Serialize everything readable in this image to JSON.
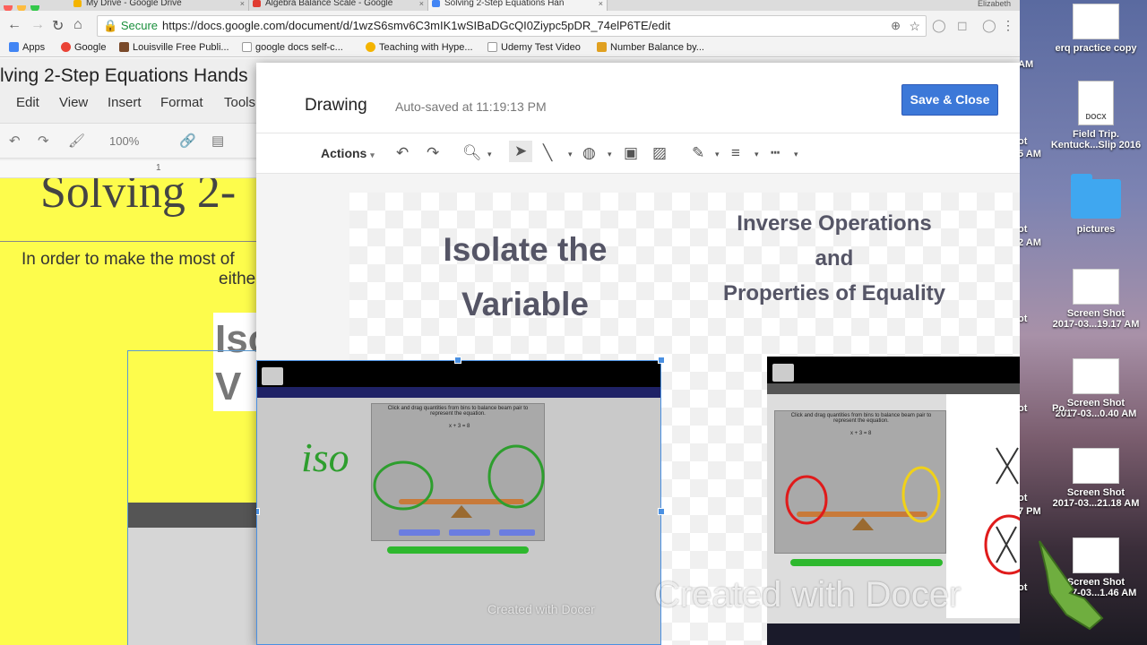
{
  "browser": {
    "tabs": [
      {
        "label": "My Drive - Google Drive",
        "color": "#f4b400"
      },
      {
        "label": "Algebra Balance Scale - Google",
        "color": "#e03c31"
      },
      {
        "label": "Solving 2-Step Equations Han",
        "color": "#4285f4"
      }
    ],
    "tab_close": "×",
    "user_label": "Elizabeth",
    "secure_label": "Secure",
    "url": "https://docs.google.com/document/d/1wzS6smv6C3mIK1wSIBaDGcQI0Ziypc5pDR_74elP6TE/edit",
    "bookmarks": [
      {
        "label": "Apps",
        "icon": "apps-icon"
      },
      {
        "label": "Google",
        "icon": "google-icon"
      },
      {
        "label": "Louisville Free Publi...",
        "icon": "library-icon"
      },
      {
        "label": "google docs self-c...",
        "icon": "page-icon"
      },
      {
        "label": "Teaching with Hype...",
        "icon": "pin-icon"
      },
      {
        "label": "Udemy Test Video",
        "icon": "page-icon"
      },
      {
        "label": "Number Balance by...",
        "icon": "balance-icon"
      }
    ]
  },
  "docs": {
    "title": "lving 2-Step Equations Hands",
    "menu": [
      "Edit",
      "View",
      "Insert",
      "Format",
      "Tools"
    ],
    "zoom": "100%",
    "ruler_mark": "1",
    "page_heading": "Solving 2-",
    "intro_line1": "In order to make the most of",
    "intro_line2": "eithe",
    "image_text": "Iso\nV"
  },
  "dialog": {
    "title": "Drawing",
    "autosave": "Auto-saved at 11:19:13 PM",
    "save_button": "Save & Close",
    "actions_label": "Actions",
    "heading_left": "Isolate the Variable",
    "heading_right_lines": [
      "Inverse Operations",
      "and",
      "Properties of Equality"
    ],
    "handwriting": "iso",
    "video_header_left": "Click and drag quantities from bins to balance beam pair to represent the equation.",
    "video_header_right": "Click and drag quantities from bins to balance beam pair to represent the equation.",
    "equation": "x + 3 = 8",
    "watermark_large": "Created with Docer",
    "watermark_small": "Created with Docer"
  },
  "desktop": {
    "icons": [
      {
        "label": "erq practice copy",
        "kind": "thumb"
      },
      {
        "label": "Field Trip.\nKentuck...Slip 2016",
        "kind": "docx"
      },
      {
        "label": "pictures",
        "kind": "folder"
      },
      {
        "label": "Screen Shot\n2017-03...19.17 AM",
        "kind": "thumb"
      },
      {
        "label": "Screen Shot\n2017-03...0.40 AM",
        "kind": "thumb"
      },
      {
        "label": "Screen Shot\n2017-03...21.18 AM",
        "kind": "thumb"
      },
      {
        "label": "Screen Shot\n2017-03...1.46 AM",
        "kind": "thumb"
      }
    ],
    "partial_label_5": "Po...",
    "side_fragments": [
      "AM",
      "ot",
      "5 AM",
      "ot",
      "2 AM",
      "ot",
      "ot",
      "7 PM",
      "ot",
      "ot"
    ]
  },
  "colors": {
    "accent_blue": "#3c78d8",
    "page_yellow": "#fdfc4c",
    "circle_green": "#2e9e2e",
    "circle_red": "#e01b1b",
    "circle_yellow": "#f0d11a"
  }
}
